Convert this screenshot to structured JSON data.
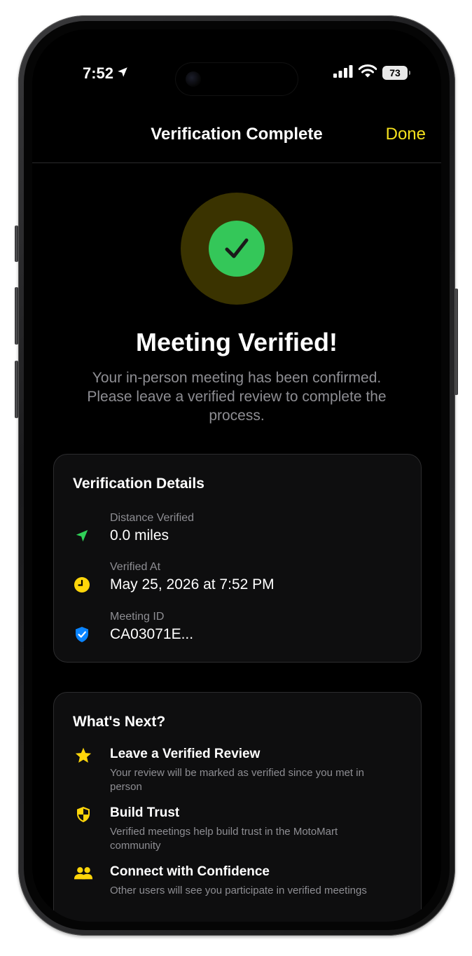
{
  "status_bar": {
    "time": "7:52",
    "battery": "73"
  },
  "nav": {
    "title": "Verification Complete",
    "done_label": "Done"
  },
  "hero": {
    "title": "Meeting Verified!",
    "subtitle": "Your in-person meeting has been confirmed. Please leave a verified review to complete the process."
  },
  "details": {
    "title": "Verification Details",
    "items": [
      {
        "label": "Distance Verified",
        "value": "0.0 miles",
        "icon": "location-arrow-icon"
      },
      {
        "label": "Verified At",
        "value": "May 25, 2026 at 7:52 PM",
        "icon": "clock-icon"
      },
      {
        "label": "Meeting ID",
        "value": "CA03071E...",
        "icon": "shield-check-icon"
      }
    ]
  },
  "next": {
    "title": "What's Next?",
    "items": [
      {
        "title": "Leave a Verified Review",
        "description": "Your review will be marked as verified since you met in person",
        "icon": "star-icon"
      },
      {
        "title": "Build Trust",
        "description": "Verified meetings help build trust in the MotoMart community",
        "icon": "shield-icon"
      },
      {
        "title": "Connect with Confidence",
        "description": "Other users will see you participate in verified meetings",
        "icon": "people-icon"
      }
    ]
  },
  "colors": {
    "accent": "#f5e11d",
    "success": "#34c759",
    "location": "#30d158",
    "clock": "#ffd60a",
    "shield": "#0a84ff"
  }
}
